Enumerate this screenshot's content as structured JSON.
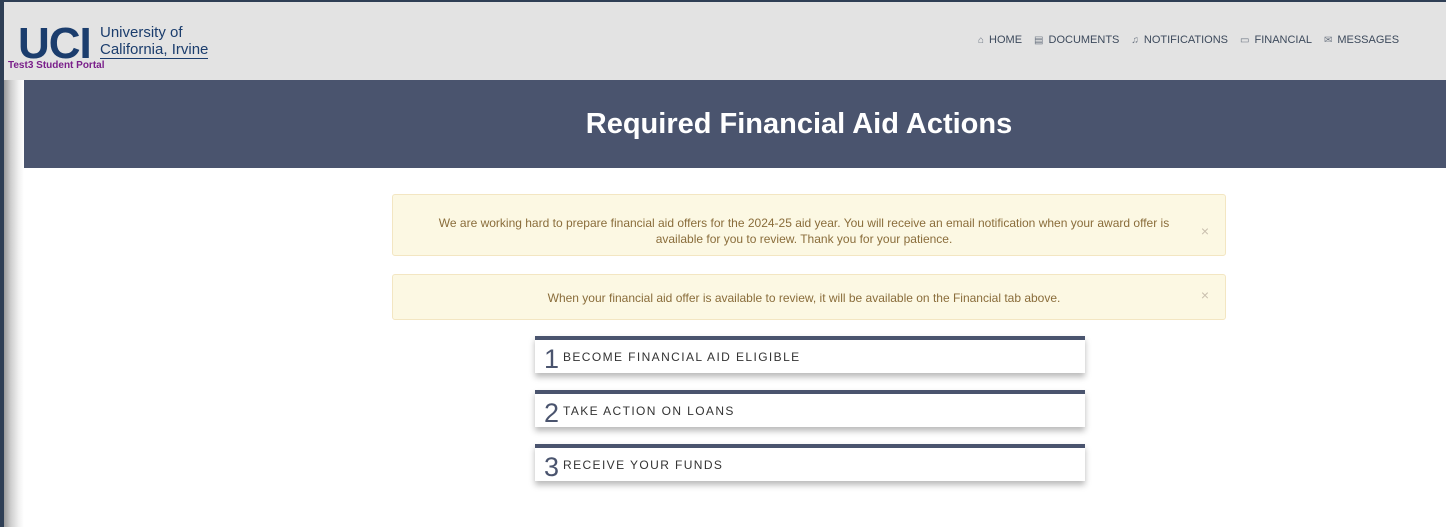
{
  "header": {
    "logo": {
      "mark": "UCI",
      "university_line1": "University of",
      "university_line2": "California, Irvine",
      "portal_name": "Test3 Student Portal"
    },
    "nav": [
      {
        "label": "HOME",
        "icon": "home-icon",
        "glyph": "⌂"
      },
      {
        "label": "DOCUMENTS",
        "icon": "document-icon",
        "glyph": "▤"
      },
      {
        "label": "NOTIFICATIONS",
        "icon": "bell-icon",
        "glyph": "♫"
      },
      {
        "label": "FINANCIAL",
        "icon": "credit-card-icon",
        "glyph": "▭"
      },
      {
        "label": "MESSAGES",
        "icon": "envelope-icon",
        "glyph": "✉"
      }
    ]
  },
  "banner": {
    "title": "Required Financial Aid Actions"
  },
  "alerts": [
    {
      "text": "We are working hard to prepare financial aid offers for the 2024-25 aid year. You will receive an email notification when your award offer is available for you to review. Thank you for your patience.",
      "close": "×"
    },
    {
      "text": "When your financial aid offer is available to review, it will be available on the Financial tab above.",
      "close": "×"
    }
  ],
  "steps": [
    {
      "number": "1",
      "label": "BECOME FINANCIAL AID ELIGIBLE"
    },
    {
      "number": "2",
      "label": "TAKE ACTION ON LOANS"
    },
    {
      "number": "3",
      "label": "RECEIVE YOUR FUNDS"
    }
  ],
  "colors": {
    "brand_navy": "#1b3d6d",
    "banner": "#4a546e",
    "alert_bg": "#fcf8e3",
    "alert_text": "#8a6d3b",
    "portal_purple": "#7a1f8a"
  }
}
